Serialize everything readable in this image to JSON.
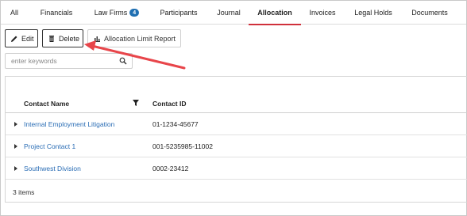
{
  "tabs": [
    {
      "label": "All"
    },
    {
      "label": "Financials"
    },
    {
      "label": "Law Firms",
      "badge": "4"
    },
    {
      "label": "Participants"
    },
    {
      "label": "Journal"
    },
    {
      "label": "Allocation"
    },
    {
      "label": "Invoices"
    },
    {
      "label": "Legal Holds"
    },
    {
      "label": "Documents"
    }
  ],
  "active_tab": "Allocation",
  "toolbar": {
    "edit_label": "Edit",
    "delete_label": "Delete",
    "report_label": "Allocation Limit Report"
  },
  "search": {
    "placeholder": "enter keywords",
    "value": ""
  },
  "grid": {
    "columns": [
      "Contact Name",
      "Contact ID"
    ],
    "rows": [
      {
        "name": "Internal Employment Litigation",
        "id": "01-1234-45677"
      },
      {
        "name": "Project Contact 1",
        "id": "001-5235985-11002"
      },
      {
        "name": "Southwest Division",
        "id": "0002-23412"
      }
    ],
    "footer": "3 items"
  },
  "colors": {
    "accent": "#d0303b",
    "link": "#2a6db5",
    "badge": "#1f6fb2",
    "annotation_arrow": "#e8454a"
  },
  "icons": {
    "edit": "pencil-icon",
    "delete": "trash-icon",
    "report": "bar-chart-icon",
    "search": "search-icon",
    "filter": "filter-icon",
    "expand": "expand-arrow-icon"
  }
}
